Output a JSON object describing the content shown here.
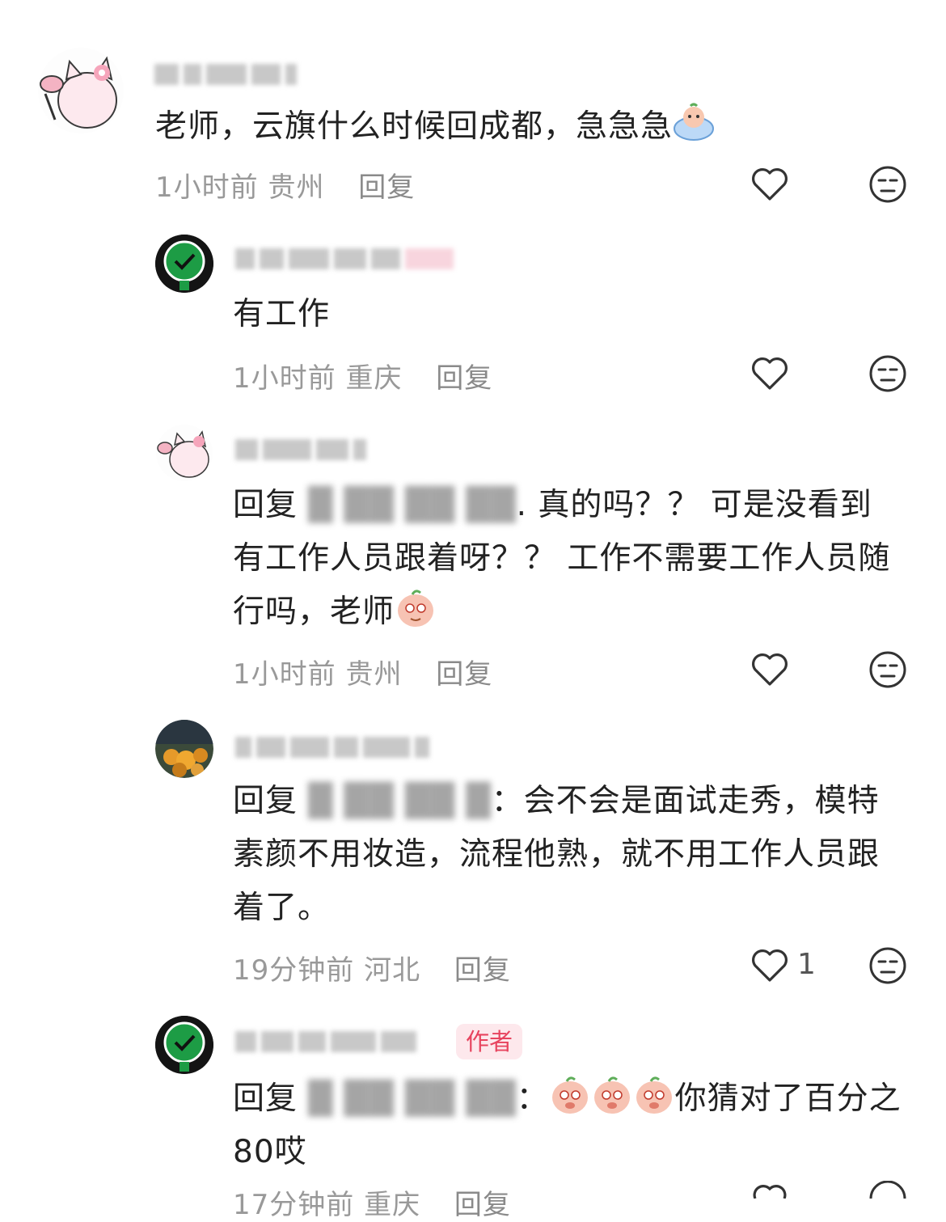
{
  "comments": [
    {
      "name": "",
      "text": "老师，云旗什么时候回成都，急急急",
      "time": "1小时前",
      "location": "贵州",
      "reply": "回复",
      "likes": ""
    },
    {
      "name": "",
      "text": "有工作",
      "time": "1小时前",
      "location": "重庆",
      "reply": "回复",
      "likes": ""
    },
    {
      "name": "",
      "text_prefix": "回复",
      "text": ". 真的吗？？ 可是没看到有工作人员跟着呀？？ 工作不需要工作人员随行吗，老师",
      "time": "1小时前",
      "location": "贵州",
      "reply": "回复",
      "likes": ""
    },
    {
      "name": "",
      "text_prefix": "回复",
      "text": "：会不会是面试走秀，模特素颜不用妆造，流程他熟，就不用工作人员跟着了。",
      "time": "19分钟前",
      "location": "河北",
      "reply": "回复",
      "likes": "1"
    },
    {
      "name": "",
      "badge": "作者",
      "text_prefix": "回复",
      "text": "你猜对了百分之80哎",
      "text_colon": "：",
      "time": "17分钟前",
      "location": "重庆",
      "reply": "回复",
      "likes": ""
    }
  ],
  "icons": {
    "like": "heart-outline-icon",
    "dislike": "meh-face-icon"
  },
  "colors": {
    "accent": "#e7435e",
    "meta": "#999999",
    "text": "#222222"
  }
}
